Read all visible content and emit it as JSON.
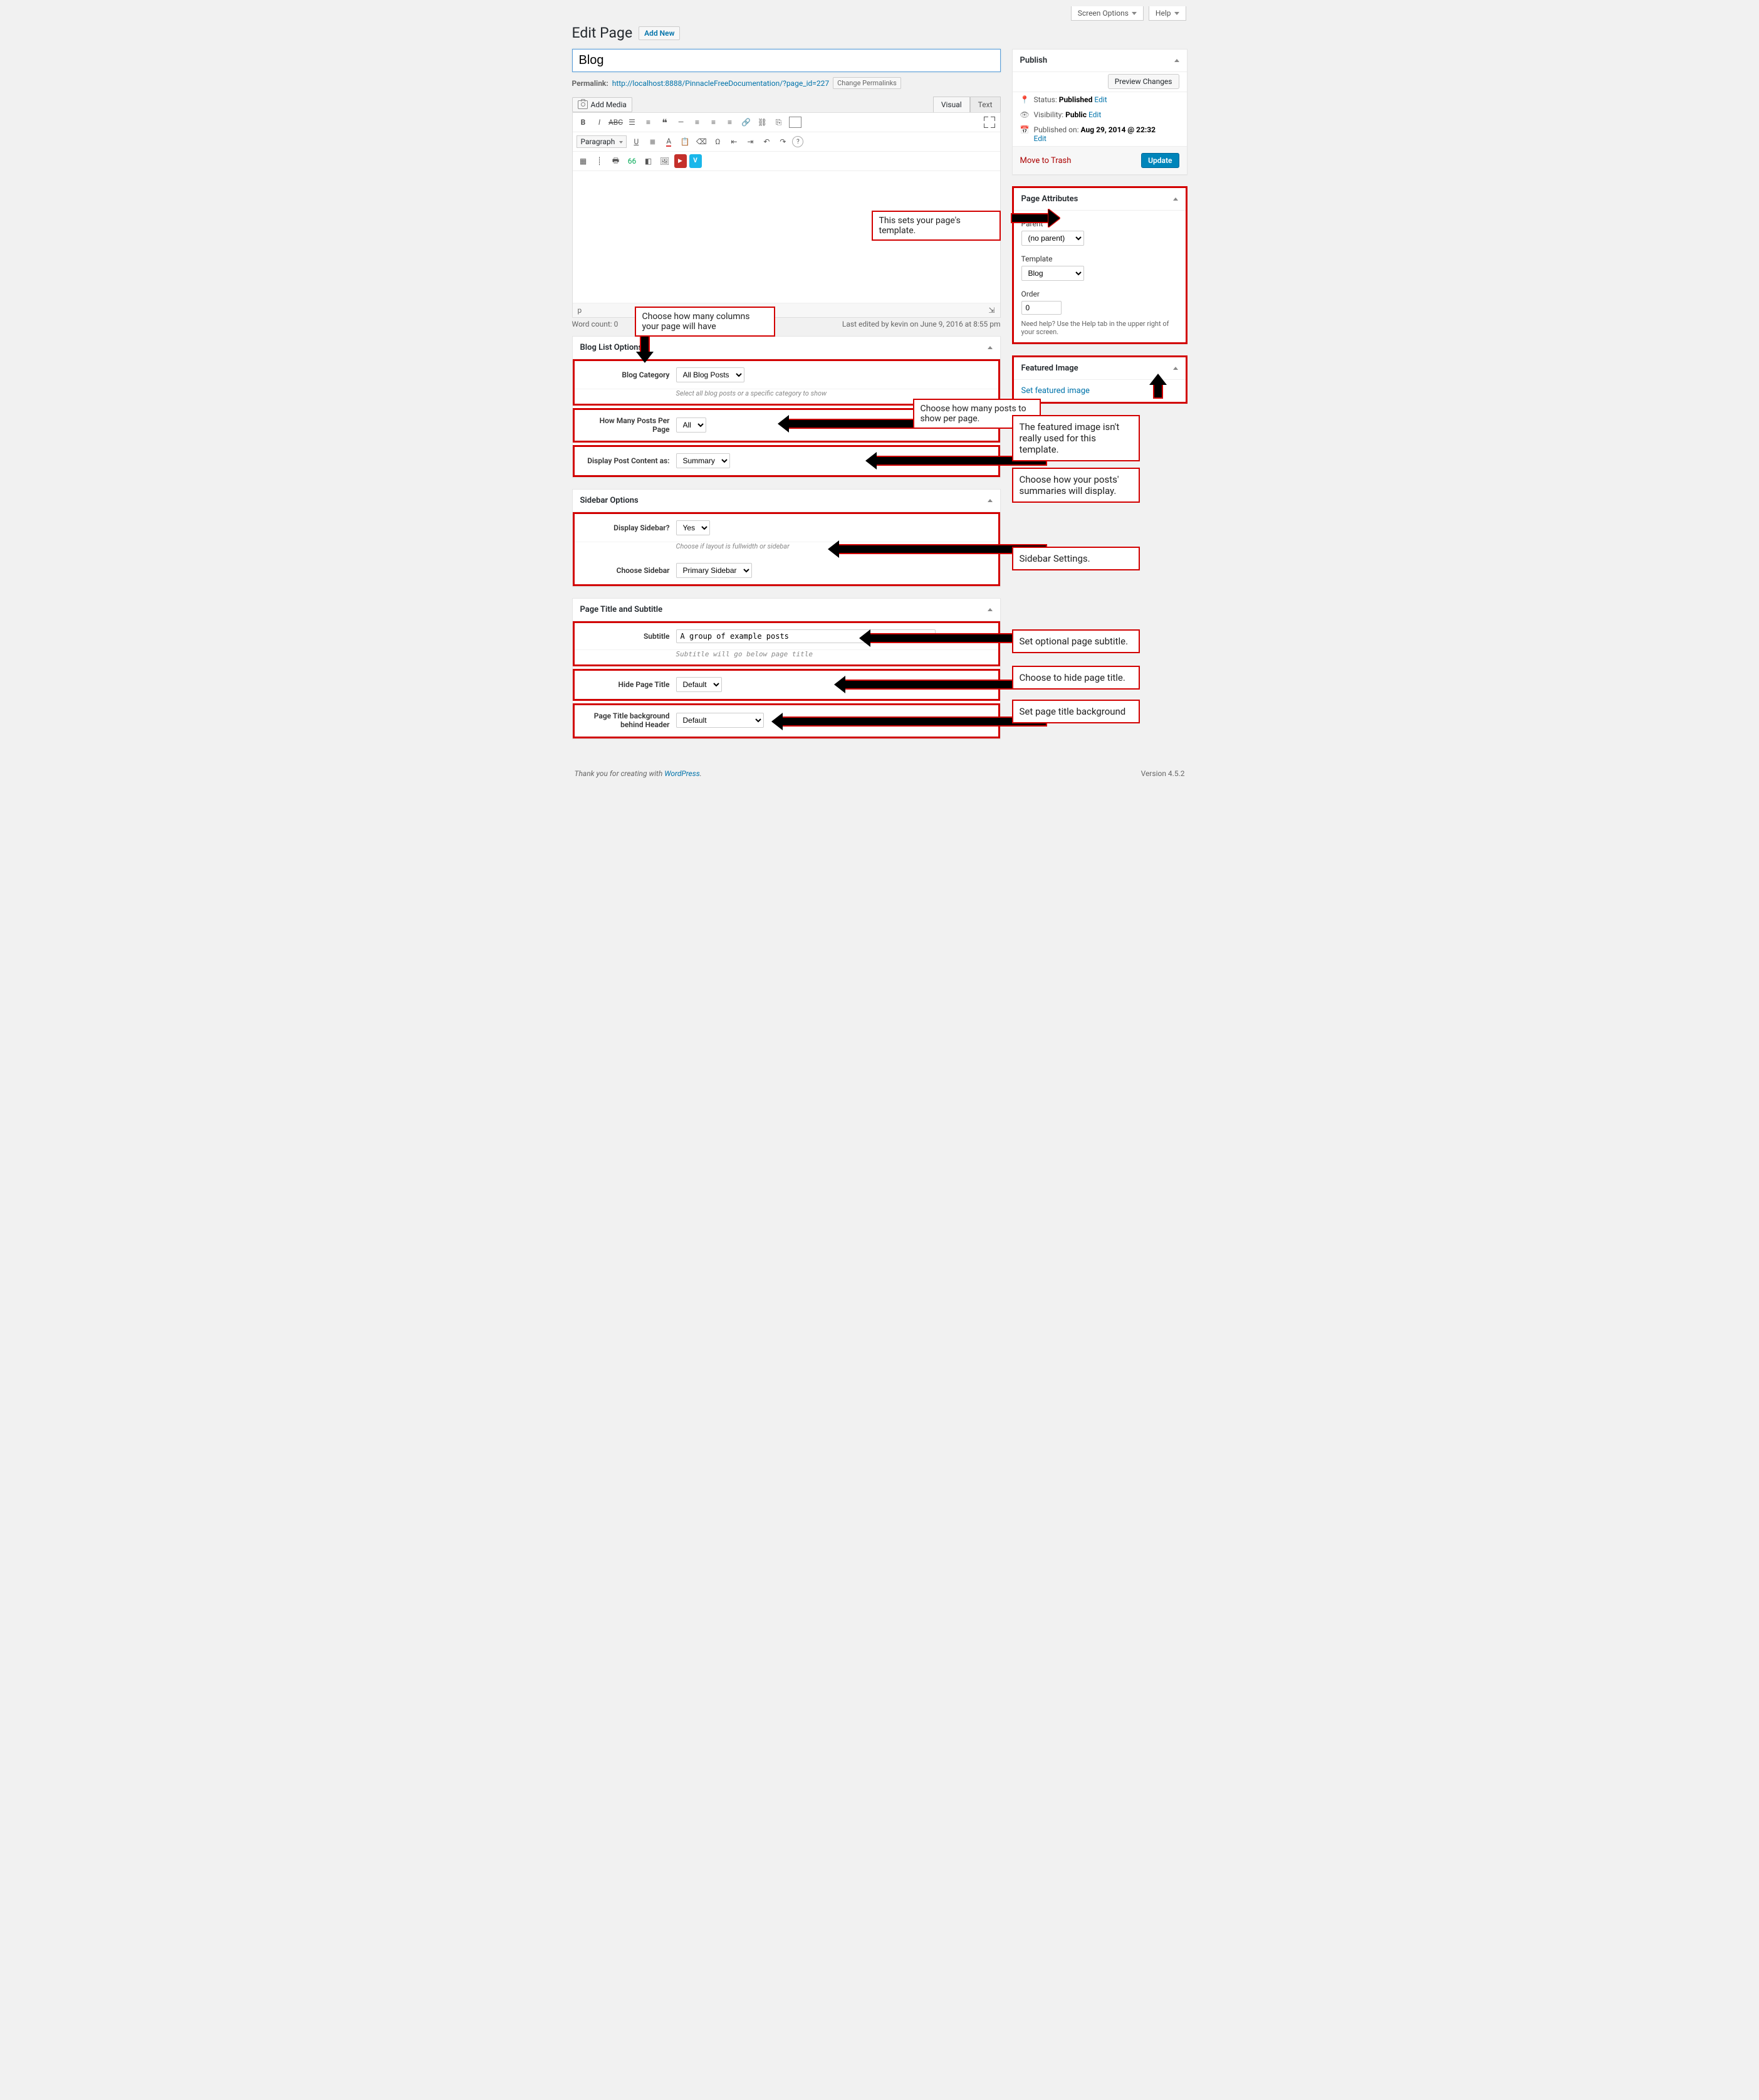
{
  "topbar": {
    "screen_options": "Screen Options",
    "help": "Help"
  },
  "heading": {
    "title": "Edit Page",
    "add_new": "Add New"
  },
  "title_input": "Blog",
  "permalink": {
    "label": "Permalink:",
    "url": "http://localhost:8888/PinnacleFreeDocumentation/?page_id=227",
    "change_btn": "Change Permalinks"
  },
  "media": {
    "add_media": "Add Media"
  },
  "editor_tabs": {
    "visual": "Visual",
    "text": "Text"
  },
  "toolbar": {
    "paragraph": "Paragraph"
  },
  "status_path": "p",
  "word_count_label": "Word count: 0",
  "last_edited": "Last edited by kevin on June 9, 2016 at 8:55 pm",
  "publish": {
    "title": "Publish",
    "preview": "Preview Changes",
    "status_label": "Status:",
    "status_value": "Published",
    "visibility_label": "Visibility:",
    "visibility_value": "Public",
    "published_on_label": "Published on:",
    "published_on_value": "Aug 29, 2014 @ 22:32",
    "edit": "Edit",
    "trash": "Move to Trash",
    "update": "Update"
  },
  "page_attributes": {
    "title": "Page Attributes",
    "parent_label": "Parent",
    "parent_value": "(no parent)",
    "template_label": "Template",
    "template_value": "Blog",
    "order_label": "Order",
    "order_value": "0",
    "help": "Need help? Use the Help tab in the upper right of your screen."
  },
  "featured_image": {
    "title": "Featured Image",
    "set_link": "Set featured image"
  },
  "blog_list": {
    "title": "Blog List Options",
    "cat_label": "Blog Category",
    "cat_value": "All Blog Posts",
    "cat_help": "Select all blog posts or a specific category to show",
    "ppp_label": "How Many Posts Per Page",
    "ppp_value": "All",
    "content_label": "Display Post Content as:",
    "content_value": "Summary"
  },
  "sidebar_opts": {
    "title": "Sidebar Options",
    "display_label": "Display Sidebar?",
    "display_value": "Yes",
    "display_help": "Choose if layout is fullwidth or sidebar",
    "choose_label": "Choose Sidebar",
    "choose_value": "Primary Sidebar"
  },
  "page_title_opts": {
    "title": "Page Title and Subtitle",
    "subtitle_label": "Subtitle",
    "subtitle_value": "A group of example posts",
    "subtitle_help": "Subtitle will go below page title",
    "hide_label": "Hide Page Title",
    "hide_value": "Default",
    "bg_label": "Page Title background behind Header",
    "bg_value": "Default"
  },
  "annotations": {
    "template": "This sets your page's template.",
    "columns": "Choose how many columns your page will have",
    "ppp": "Choose how many posts to show per page.",
    "featured": "The featured image isn't really used for this template.",
    "summaries": "Choose how your posts' summaries will display.",
    "sidebar": "Sidebar Settings.",
    "subtitle": "Set optional page subtitle.",
    "hide_title": "Choose to hide page title.",
    "title_bg": "Set page title background"
  },
  "footer": {
    "thanks_pre": "Thank you for creating with ",
    "wp": "WordPress",
    "thanks_post": ".",
    "version": "Version 4.5.2"
  }
}
